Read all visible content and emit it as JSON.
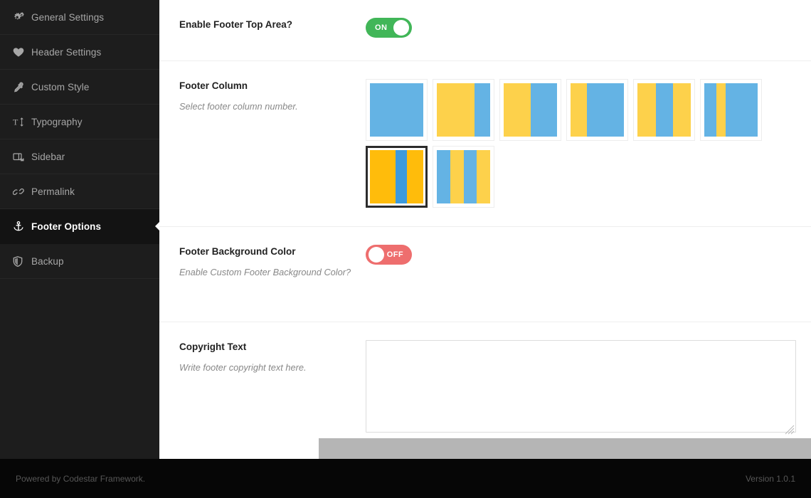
{
  "sidebar": {
    "items": [
      {
        "label": "General Settings",
        "icon": "gears-icon",
        "active": false
      },
      {
        "label": "Header Settings",
        "icon": "heart-icon",
        "active": false
      },
      {
        "label": "Custom Style",
        "icon": "eyedropper-icon",
        "active": false
      },
      {
        "label": "Typography",
        "icon": "text-height-icon",
        "active": false
      },
      {
        "label": "Sidebar",
        "icon": "columns-icon",
        "active": false
      },
      {
        "label": "Permalink",
        "icon": "chain-link-icon",
        "active": false
      },
      {
        "label": "Footer Options",
        "icon": "anchor-icon",
        "active": true
      },
      {
        "label": "Backup",
        "icon": "shield-icon",
        "active": false
      }
    ]
  },
  "fields": {
    "enable_footer_top": {
      "title": "Enable Footer Top Area?",
      "subtitle": "",
      "toggle": {
        "state": "on",
        "on_label": "ON",
        "off_label": "OFF"
      }
    },
    "footer_column": {
      "title": "Footer Column",
      "subtitle": "Select footer column number.",
      "selected_index": 6,
      "options": [
        {
          "name": "1-column",
          "segments": [
            {
              "color": "b",
              "ratio": 100
            }
          ]
        },
        {
          "name": "2-column-70-30",
          "segments": [
            {
              "color": "y",
              "ratio": 70
            },
            {
              "color": "b",
              "ratio": 30
            }
          ]
        },
        {
          "name": "2-column-50-50",
          "segments": [
            {
              "color": "y",
              "ratio": 50
            },
            {
              "color": "b",
              "ratio": 50
            }
          ]
        },
        {
          "name": "2-column-30-70",
          "segments": [
            {
              "color": "y",
              "ratio": 30
            },
            {
              "color": "b",
              "ratio": 70
            }
          ]
        },
        {
          "name": "3-column-equal",
          "segments": [
            {
              "color": "y",
              "ratio": 34
            },
            {
              "color": "b",
              "ratio": 32
            },
            {
              "color": "y",
              "ratio": 34
            }
          ]
        },
        {
          "name": "3-column-22-18-60",
          "segments": [
            {
              "color": "b",
              "ratio": 22
            },
            {
              "color": "y",
              "ratio": 18
            },
            {
              "color": "b",
              "ratio": 60
            }
          ]
        },
        {
          "name": "3-column-48-20-32",
          "segments": [
            {
              "color": "y",
              "ratio": 48
            },
            {
              "color": "b",
              "ratio": 21
            },
            {
              "color": "y",
              "ratio": 31
            }
          ]
        },
        {
          "name": "4-column-equal",
          "segments": [
            {
              "color": "b",
              "ratio": 25
            },
            {
              "color": "y",
              "ratio": 25
            },
            {
              "color": "b",
              "ratio": 25
            },
            {
              "color": "y",
              "ratio": 25
            }
          ]
        }
      ]
    },
    "footer_background_color": {
      "title": "Footer Background Color",
      "subtitle": "Enable Custom Footer Background Color?",
      "toggle": {
        "state": "off",
        "on_label": "ON",
        "off_label": "OFF"
      }
    },
    "copyright_text": {
      "title": "Copyright Text",
      "subtitle": "Write footer copyright text here.",
      "value": "",
      "placeholder": ""
    }
  },
  "footer": {
    "powered_by": "Powered by Codestar Framework.",
    "version": "Version 1.0.1"
  },
  "colors": {
    "sidebar_bg": "#1d1d1d",
    "sidebar_active_bg": "#131313",
    "toggle_on": "#41b658",
    "toggle_off": "#ee6e6e",
    "swatch_yellow": "#fdd14b",
    "swatch_blue": "#64b3e4",
    "swatch_yellow_selected": "#ffbc0b",
    "swatch_blue_selected": "#3c9add",
    "savebar": "#b5b5b5",
    "footer_strip": "#060606"
  }
}
